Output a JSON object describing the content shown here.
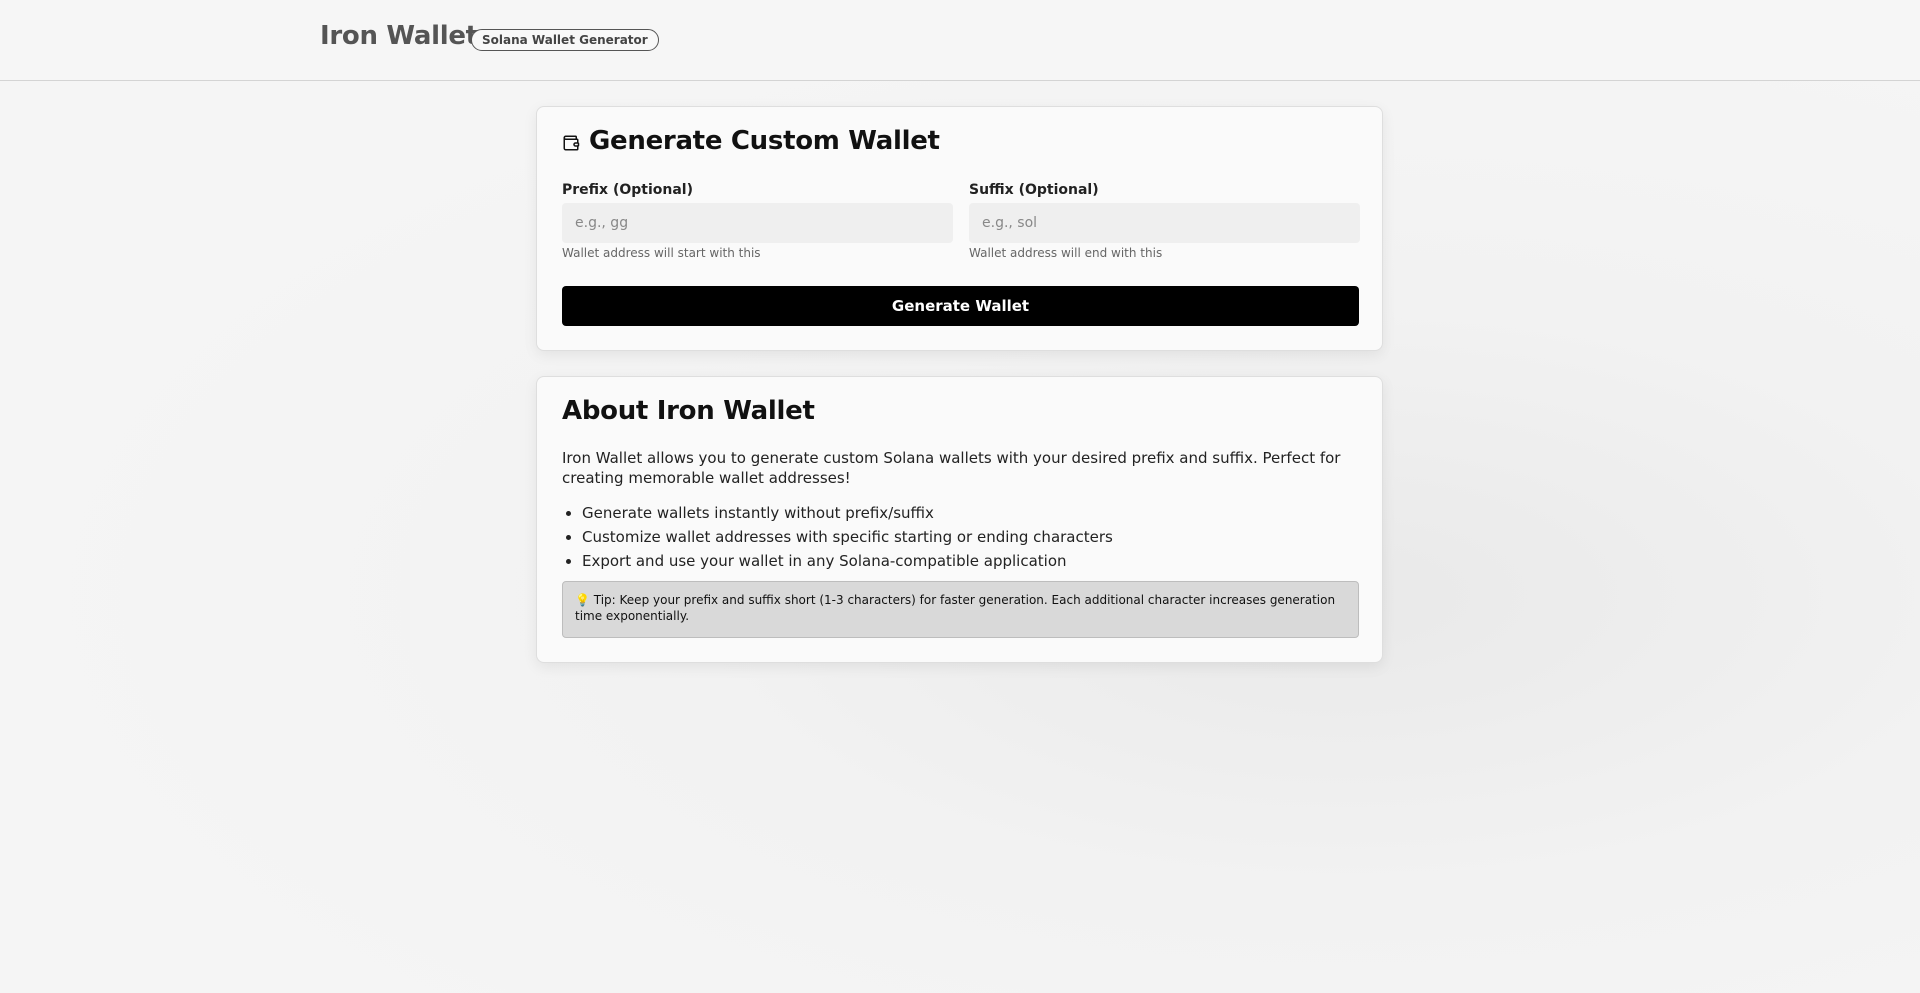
{
  "header": {
    "brand": "Iron Wallet",
    "badge": "Solana Wallet Generator"
  },
  "generator": {
    "icon": "wallet-icon",
    "title": "Generate Custom Wallet",
    "prefix": {
      "label": "Prefix (Optional)",
      "placeholder": "e.g., gg",
      "value": "",
      "hint": "Wallet address will start with this"
    },
    "suffix": {
      "label": "Suffix (Optional)",
      "placeholder": "e.g., sol",
      "value": "",
      "hint": "Wallet address will end with this"
    },
    "button_label": "Generate Wallet"
  },
  "about": {
    "title": "About Iron Wallet",
    "description": "Iron Wallet allows you to generate custom Solana wallets with your desired prefix and suffix. Perfect for creating memorable wallet addresses!",
    "features": [
      "Generate wallets instantly without prefix/suffix",
      "Customize wallet addresses with specific starting or ending characters",
      "Export and use your wallet in any Solana-compatible application"
    ],
    "tip": "💡 Tip: Keep your prefix and suffix short (1-3 characters) for faster generation. Each additional character increases generation time exponentially."
  },
  "colors": {
    "button_bg": "#000000",
    "tip_bg": "#d9d9d9",
    "brand_text": "#555555"
  }
}
